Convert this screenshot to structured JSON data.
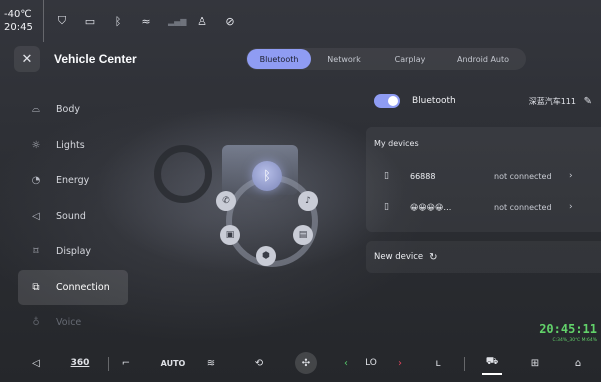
{
  "status_bar": {
    "temperature": "-40℃",
    "time": "20:45",
    "icons": [
      "shield-icon",
      "tag-icon",
      "bluetooth-icon",
      "wifi-icon",
      "signal-icon",
      "person-icon",
      "eye-off-icon"
    ]
  },
  "header": {
    "title": "Vehicle Center",
    "tabs": [
      {
        "label": "Bluetooth",
        "active": true
      },
      {
        "label": "Network",
        "active": false
      },
      {
        "label": "Carplay",
        "active": false
      },
      {
        "label": "Android Auto",
        "active": false
      }
    ]
  },
  "sidebar": {
    "items": [
      {
        "label": "Body"
      },
      {
        "label": "Lights"
      },
      {
        "label": "Energy"
      },
      {
        "label": "Sound"
      },
      {
        "label": "Display"
      },
      {
        "label": "Connection",
        "active": true
      },
      {
        "label": "Voice"
      }
    ]
  },
  "bluetooth": {
    "label": "Bluetooth",
    "enabled": true,
    "car_name": "深蓝汽车111"
  },
  "devices": {
    "title": "My devices",
    "list": [
      {
        "name": "66888",
        "status": "not connected"
      },
      {
        "name": "😀😀😀😀…",
        "status": "not connected"
      }
    ]
  },
  "new_device": {
    "label": "New device"
  },
  "overlay": {
    "clock": "20:45:11",
    "stats": "C:34%_30℃ M:64%"
  },
  "dock": {
    "btn_360": "360",
    "auto": "AUTO",
    "temp": "LO"
  },
  "colors": {
    "accent": "#8f9cf3",
    "green": "#62d26a",
    "red": "#e0445c"
  }
}
